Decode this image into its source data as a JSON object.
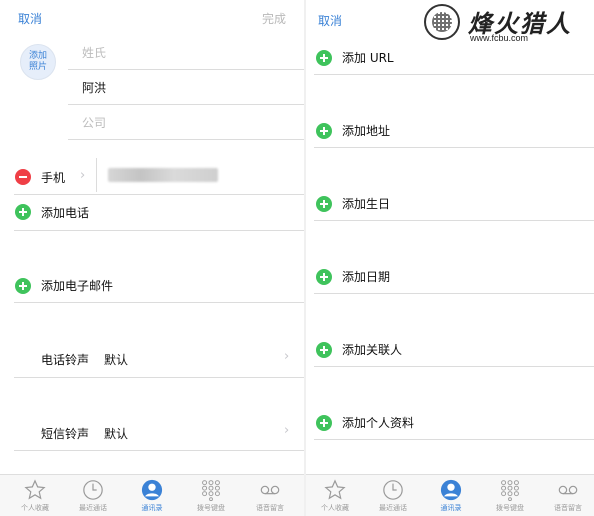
{
  "left": {
    "nav": {
      "cancel": "取消",
      "done": "完成"
    },
    "photo": "添加\n照片",
    "fields": {
      "last_name_placeholder": "姓氏",
      "first_name": "阿洪",
      "company_placeholder": "公司"
    },
    "phone": {
      "label": "手机"
    },
    "rows": {
      "add_phone": "添加电话",
      "add_email": "添加电子邮件"
    },
    "ringtone": {
      "label": "电话铃声",
      "value": "默认"
    },
    "text_tone": {
      "label": "短信铃声",
      "value": "默认"
    }
  },
  "right": {
    "nav": {
      "cancel": "取消"
    },
    "rows": [
      "添加 URL",
      "添加地址",
      "添加生日",
      "添加日期",
      "添加关联人",
      "添加个人资料"
    ]
  },
  "tabs": [
    "个人收藏",
    "最近通话",
    "通讯录",
    "拨号键盘",
    "语音留言"
  ],
  "active_tab": "通讯录",
  "watermark": {
    "title": "烽火猎人",
    "url": "www.fcbu.com"
  },
  "colors": {
    "accent": "#3b82d6",
    "add": "#3fc35c",
    "remove": "#ef3f46"
  }
}
